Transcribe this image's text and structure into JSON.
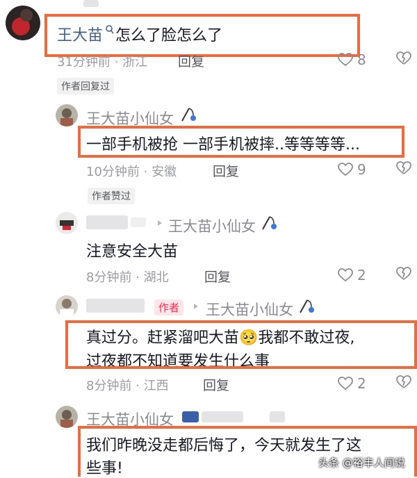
{
  "comments": [
    {
      "user": "王大苗",
      "text": "怎么了脸怎么了",
      "time_location": "31分钟前 · 浙江",
      "reply": "回复",
      "likes": "8",
      "tag": "作者回复过"
    },
    {
      "user": "王大苗小仙女",
      "text": "一部手机被抢 一部手机被摔..等等等等...",
      "time_location": "10分钟前 · 安徽",
      "reply": "回复",
      "likes": "9",
      "tag": "作者赞过"
    },
    {
      "reply_to": "王大苗小仙女",
      "text": "注意安全大苗",
      "time_location": "8分钟前 · 湖北",
      "reply": "回复",
      "likes": "2"
    },
    {
      "badge": "作者",
      "reply_to": "王大苗小仙女",
      "text_line1": "真过分。赶紧溜吧大苗🥺我都不敢过夜,",
      "text_line2": "过夜都不知道要发生什么事",
      "time_location": "8分钟前 · 江西",
      "reply": "回复",
      "likes": "2"
    },
    {
      "user": "王大苗小仙女",
      "text_line1": "我们昨晚没走都后悔了，今天就发生了这",
      "text_line2": "些事!"
    }
  ],
  "watermark": "头条 @裕丰人间说",
  "colors": {
    "highlight_border": "#ec6a3c",
    "author_badge": "#fe2c55",
    "username_blue": "#3f5f8a"
  },
  "icons": [
    "heart-outline-icon",
    "broken-heart-icon",
    "search-small-icon",
    "fishing-rod-badge-icon",
    "reply-arrow-icon"
  ]
}
